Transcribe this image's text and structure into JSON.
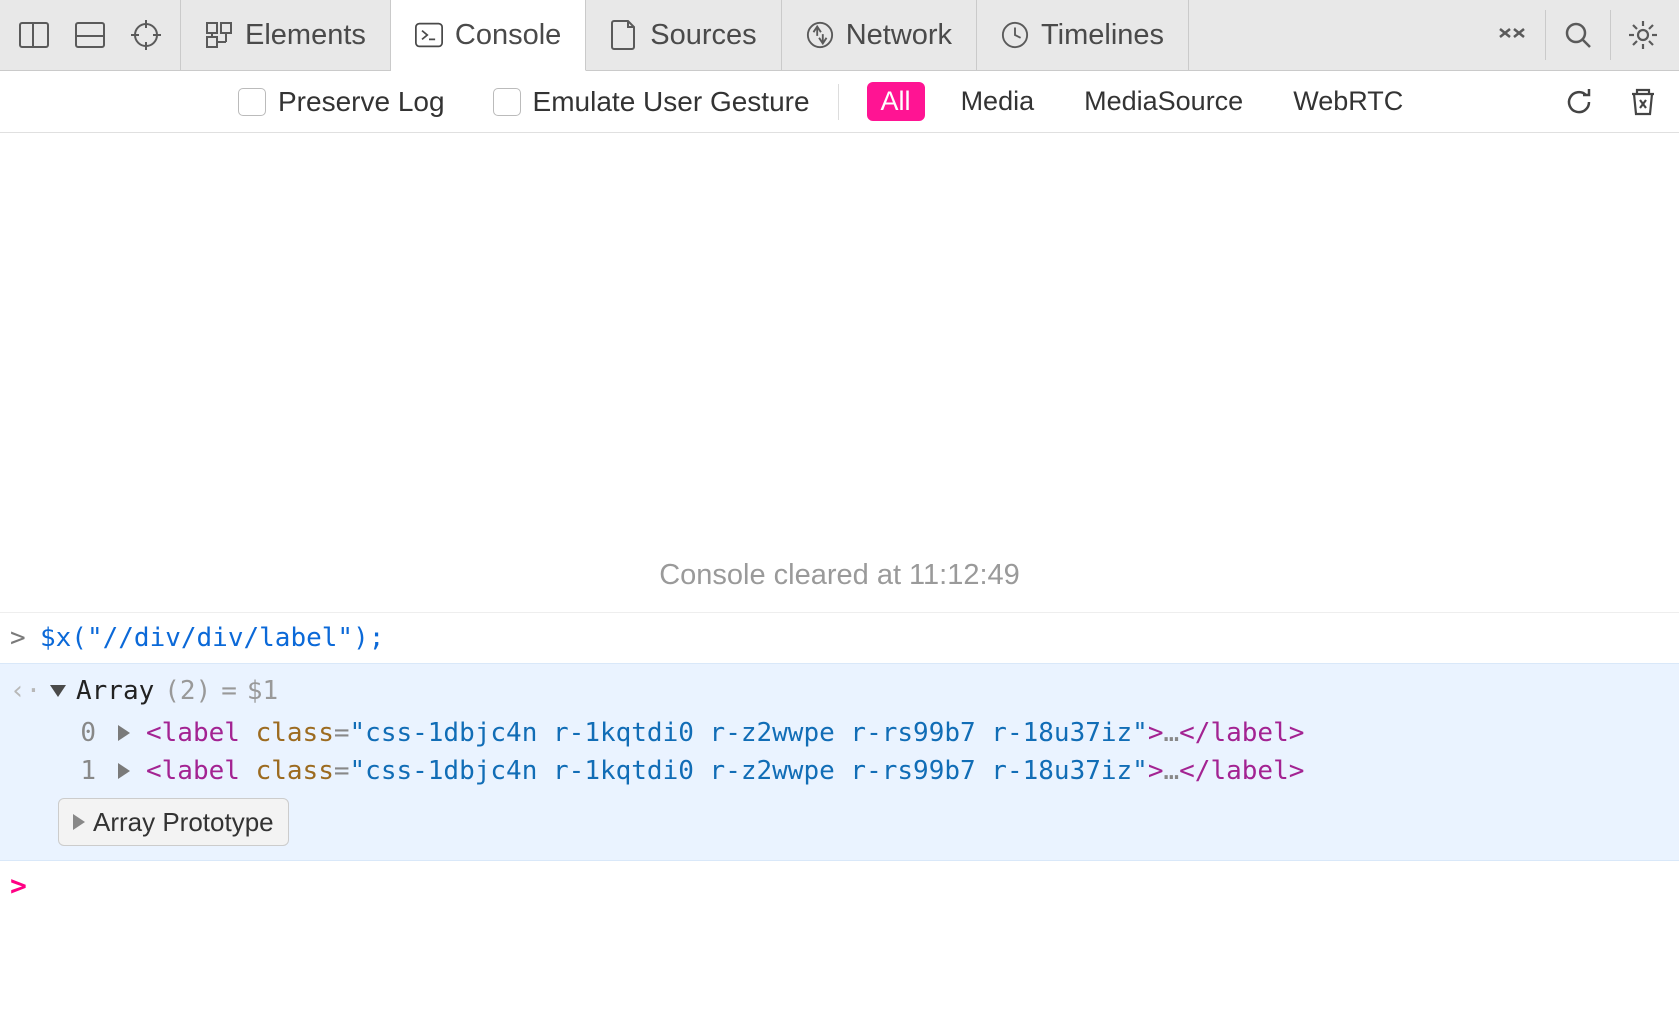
{
  "toolbar": {
    "tabs": [
      {
        "label": "Elements"
      },
      {
        "label": "Console"
      },
      {
        "label": "Sources"
      },
      {
        "label": "Network"
      },
      {
        "label": "Timelines"
      }
    ]
  },
  "filter": {
    "preserve_log": "Preserve Log",
    "emulate_gesture": "Emulate User Gesture",
    "scopes": [
      "All",
      "Media",
      "MediaSource",
      "WebRTC"
    ]
  },
  "console": {
    "cleared_text": "Console cleared at 11:12:49",
    "input_prompt": ">",
    "command": "$x(\"//div/div/label\");",
    "result_gutter": "<",
    "array_label": "Array",
    "array_count": "(2)",
    "eq": "=",
    "dollar": "$1",
    "items": [
      {
        "idx": "0",
        "tag_open": "<label ",
        "class_attr_name": "class",
        "class_attr_val": "\"css-1dbjc4n r-1kqtdi0 r-z2wwpe r-rs99b7 r-18u37iz\"",
        "close1": ">",
        "ellipsis": "…",
        "close2": "</label>"
      },
      {
        "idx": "1",
        "tag_open": "<label ",
        "class_attr_name": "class",
        "class_attr_val": "\"css-1dbjc4n r-1kqtdi0 r-z2wwpe r-rs99b7 r-18u37iz\"",
        "close1": ">",
        "ellipsis": "…",
        "close2": "</label>"
      }
    ],
    "proto_label": "Array Prototype",
    "live_prompt": ">"
  }
}
